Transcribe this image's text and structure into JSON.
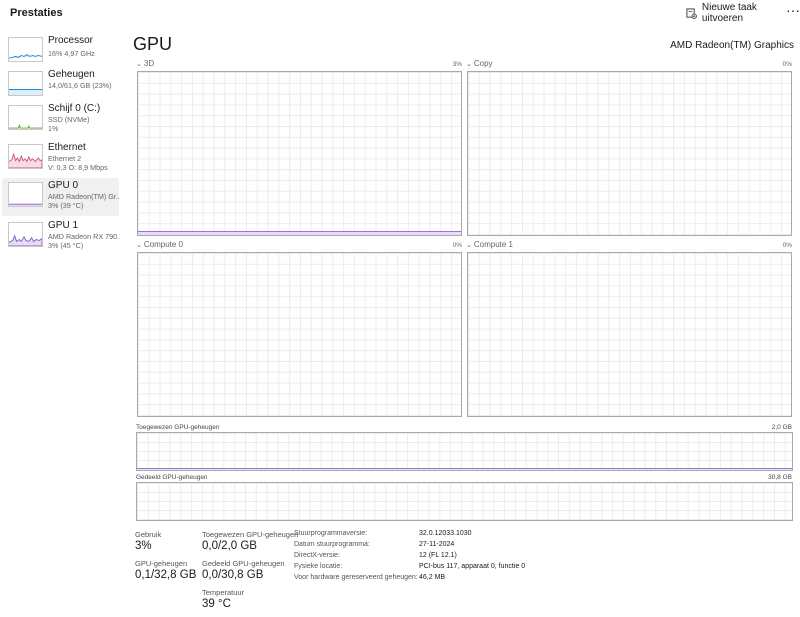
{
  "app": {
    "title": "Prestaties",
    "new_task_label": "Nieuwe taak uitvoeren",
    "more_label": "···"
  },
  "sidebar": {
    "items": [
      {
        "title": "Processor",
        "lines": [
          "16%  4,97 GHz"
        ],
        "color": "#1b8bd1",
        "selected": false
      },
      {
        "title": "Geheugen",
        "lines": [
          "14,0/61,6 GB (23%)"
        ],
        "color": "#1b8bd1",
        "selected": false
      },
      {
        "title": "Schijf 0 (C:)",
        "lines": [
          "SSD (NVMe)",
          "1%"
        ],
        "color": "#5aa02c",
        "selected": false
      },
      {
        "title": "Ethernet",
        "lines": [
          "Ethernet 2",
          "V: 0,3  O: 8,9 Mbps"
        ],
        "color": "#c8577a",
        "selected": false
      },
      {
        "title": "GPU 0",
        "lines": [
          "AMD Radeon(TM) Gr...",
          "3%  (39 °C)"
        ],
        "color": "#8b5cc4",
        "selected": true
      },
      {
        "title": "GPU 1",
        "lines": [
          "AMD Radeon RX 790...",
          "3%  (45 °C)"
        ],
        "color": "#8b5cc4",
        "selected": false
      }
    ]
  },
  "main": {
    "title": "GPU",
    "device_name": "AMD Radeon(TM) Graphics",
    "engines": [
      {
        "name": "3D",
        "percent": "3%",
        "usage": 0.03
      },
      {
        "name": "Copy",
        "percent": "0%",
        "usage": 0
      },
      {
        "name": "Compute 0",
        "percent": "0%",
        "usage": 0
      },
      {
        "name": "Compute 1",
        "percent": "0%",
        "usage": 0
      }
    ],
    "memory_graphs": [
      {
        "label": "Toegewezen GPU-geheugen",
        "max": "2,0 GB"
      },
      {
        "label": "Gedeeld GPU-geheugen",
        "max": "30,8 GB"
      }
    ],
    "stats": {
      "usage_label": "Gebruik",
      "usage_value": "3%",
      "dedicated_label": "Toegewezen GPU-geheugen",
      "dedicated_value": "0,0/2,0 GB",
      "gpu_mem_label": "GPU-geheugen",
      "gpu_mem_value": "0,1/32,8 GB",
      "shared_label": "Gedeeld GPU-geheugen",
      "shared_value": "0,0/30,8 GB",
      "temp_label": "Temperatuur",
      "temp_value": "39 °C"
    },
    "info": [
      {
        "key": "Stuurprogrammaversie:",
        "value": "32.0.12033.1030"
      },
      {
        "key": "Datum stuurprogramma:",
        "value": "27-11-2024"
      },
      {
        "key": "DirectX-versie:",
        "value": "12 (FL 12.1)"
      },
      {
        "key": "Fysieke locatie:",
        "value": "PCI-bus 117, apparaat 0, functie 0"
      },
      {
        "key": "Voor hardware gereserveerd geheugen:",
        "value": "46,2 MB"
      }
    ]
  }
}
